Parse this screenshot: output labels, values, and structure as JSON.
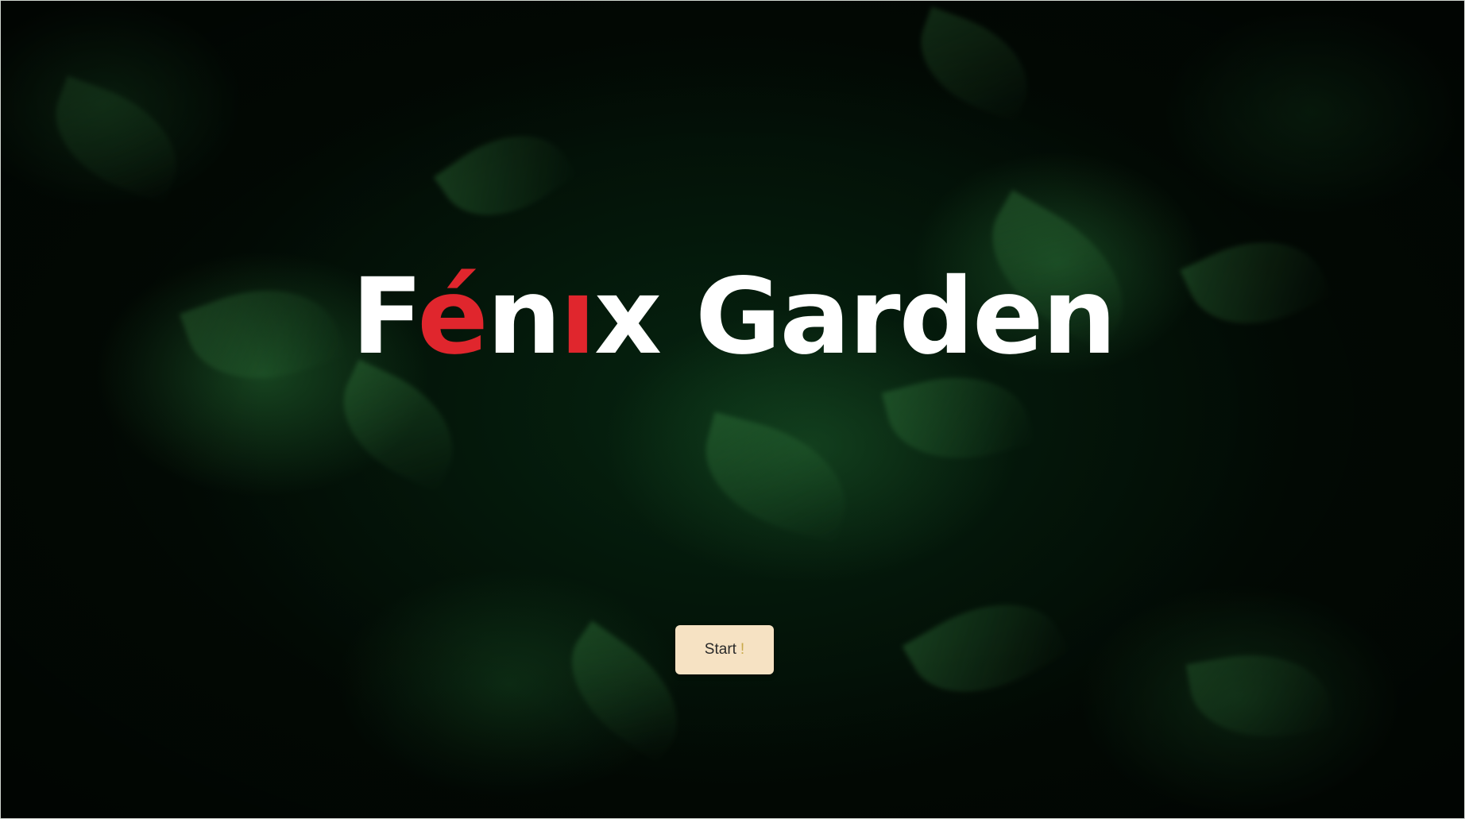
{
  "hero": {
    "title_part1": "F",
    "title_accent": "é",
    "title_part2": "n",
    "title_dotless_i": "ı",
    "title_part3": "x Garden",
    "title_full": "Fénix Garden"
  },
  "start_button": {
    "label": "Start",
    "suffix": "!"
  },
  "colors": {
    "title": "#ffffff",
    "accent": "#e0262d",
    "button_bg": "#f6e2c3",
    "background": "#020a04"
  }
}
